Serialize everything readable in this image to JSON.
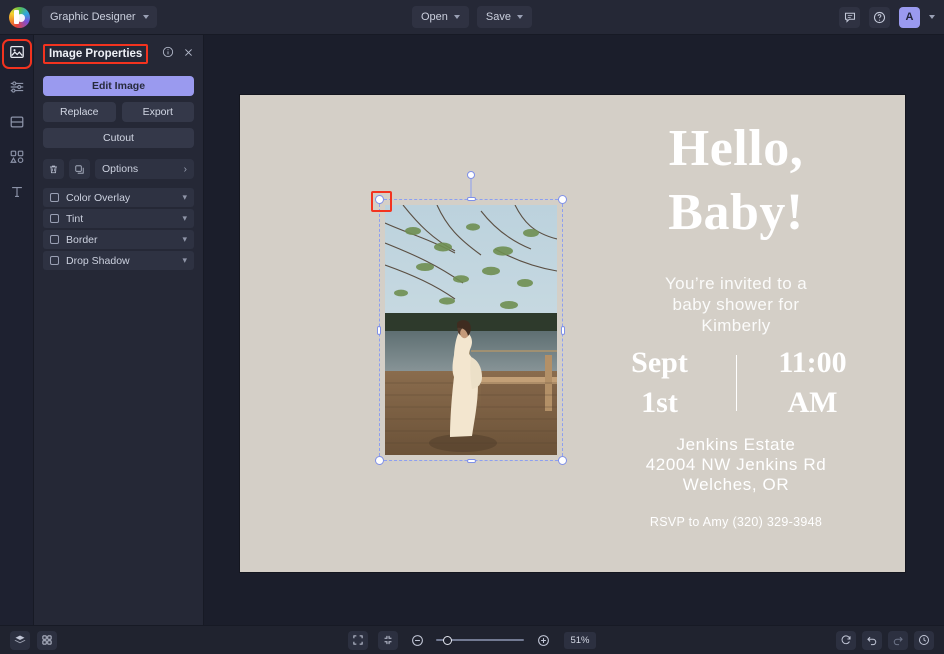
{
  "topbar": {
    "logo_icon": "befunky-logo-icon",
    "mode_label": "Graphic Designer",
    "mode_chevron_icon": "chevron-down-icon",
    "open_label": "Open",
    "save_label": "Save",
    "feedback_icon": "chat-bubble-icon",
    "help_icon": "question-circle-icon",
    "avatar_label": "A",
    "avatar_chevron_icon": "chevron-down-icon"
  },
  "rail": {
    "items": [
      {
        "name": "image-tool",
        "icon": "image-icon",
        "active": true,
        "highlighted": true
      },
      {
        "name": "adjust-tool",
        "icon": "sliders-icon",
        "active": false,
        "highlighted": false
      },
      {
        "name": "frames-tool",
        "icon": "frame-icon",
        "active": false,
        "highlighted": false
      },
      {
        "name": "graphics-tool",
        "icon": "shapes-icon",
        "active": false,
        "highlighted": false
      },
      {
        "name": "text-tool",
        "icon": "text-t-icon",
        "active": false,
        "highlighted": false
      }
    ]
  },
  "panel": {
    "title": "Image Properties",
    "info_icon": "info-circle-icon",
    "close_icon": "close-x-icon",
    "edit_image_label": "Edit Image",
    "replace_label": "Replace",
    "export_label": "Export",
    "cutout_label": "Cutout",
    "delete_icon": "trash-icon",
    "duplicate_icon": "duplicate-icon",
    "options_label": "Options",
    "options_arrow_icon": "chevron-right-icon",
    "effects": [
      {
        "label": "Color Overlay",
        "checked": false
      },
      {
        "label": "Tint",
        "checked": false
      },
      {
        "label": "Border",
        "checked": false
      },
      {
        "label": "Drop Shadow",
        "checked": false
      }
    ]
  },
  "canvas": {
    "artboard_color": "#d4cfc7",
    "background_color": "#1b1e2b",
    "design": {
      "headline_line1": "Hello,",
      "headline_line2": "Baby!",
      "subtext_line1": "You’re invited to a",
      "subtext_line2": "baby shower for",
      "subtext_line3": "Kimberly",
      "date_line1": "Sept",
      "date_line2": "1st",
      "time_line1": "11:00",
      "time_line2": "AM",
      "venue_line1": "Jenkins Estate",
      "venue_line2": "42004 NW Jenkins Rd",
      "venue_line3": "Welches, OR",
      "rsvp": "RSVP to Amy (320) 329-3948"
    },
    "selection": {
      "object": "photo-pregnant-woman-on-dock",
      "handle_highlighted": "top-left-resize-handle"
    }
  },
  "bottombar": {
    "layers_icon": "layers-icon",
    "grid_icon": "grid-icon",
    "fit_screen_icon": "fit-to-screen-icon",
    "actual_size_icon": "actual-size-icon",
    "zoom_out_icon": "zoom-out-icon",
    "zoom_in_icon": "zoom-in-icon",
    "zoom_value": "51%",
    "zoom_slider_percent": 8,
    "reset_icon": "reset-icon",
    "undo_icon": "undo-icon",
    "redo_icon": "redo-icon",
    "history_icon": "history-clock-icon"
  }
}
